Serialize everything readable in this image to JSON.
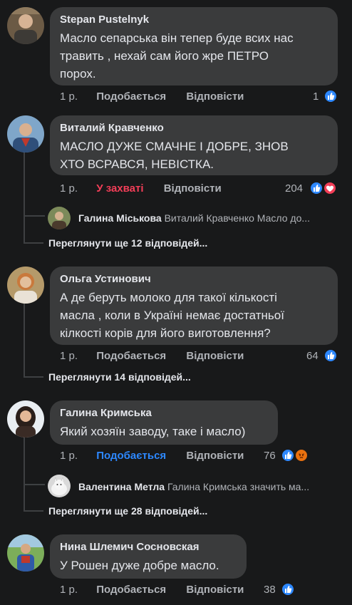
{
  "comments": [
    {
      "author": "Stepan Pustelnyk",
      "text": "Масло сепарська він тепер буде всих нас\nтравить , нехай сам його жре ПЕТРО\nпорох.",
      "time": "1 р.",
      "like_label": "Подобається",
      "reply_label": "Відповісти",
      "reaction_count": "1"
    },
    {
      "author": "Виталий Кравченко",
      "text": "МАСЛО ДУЖЕ СМАЧНЕ І ДОБРЕ, ЗНОВ\nХТО ВСРАВСЯ, НЕВІСТКА.",
      "time": "1 р.",
      "like_label": "У захваті",
      "reply_label": "Відповісти",
      "reaction_count": "204",
      "reply_preview": {
        "author": "Галина Міськова",
        "text": "Виталий Кравченко Масло до..."
      },
      "more_replies": "Переглянути ще 12 відповідей..."
    },
    {
      "author": "Ольга Устинович",
      "text": "А де беруть молоко для такої кількості\nмасла , коли в Україні немає достатньої\nкілкості корів для його виготовлення?",
      "time": "1 р.",
      "like_label": "Подобається",
      "reply_label": "Відповісти",
      "reaction_count": "64",
      "more_replies": "Переглянути 14 відповідей..."
    },
    {
      "author": "Галина Кримська",
      "text": "Який хозяїн заводу, таке і масло)",
      "time": "1 р.",
      "like_label": "Подобається",
      "reply_label": "Відповісти",
      "reaction_count": "76",
      "reply_preview": {
        "author": "Валентина Метла",
        "text": "Галина Кримська значить ма..."
      },
      "more_replies": "Переглянути ще 28 відповідей..."
    },
    {
      "author": "Нина Шлемич Сосновская",
      "text": "У Рошен дуже добре масло.",
      "time": "1 р.",
      "like_label": "Подобається",
      "reply_label": "Відповісти",
      "reaction_count": "38"
    }
  ],
  "colors": {
    "background": "#18191a",
    "bubble": "#3a3b3c",
    "like_active": "#2d88ff",
    "love_active": "#f33e58",
    "secondary_text": "#b0b3b8"
  },
  "icons": [
    "like-icon",
    "love-icon",
    "angry-icon"
  ]
}
